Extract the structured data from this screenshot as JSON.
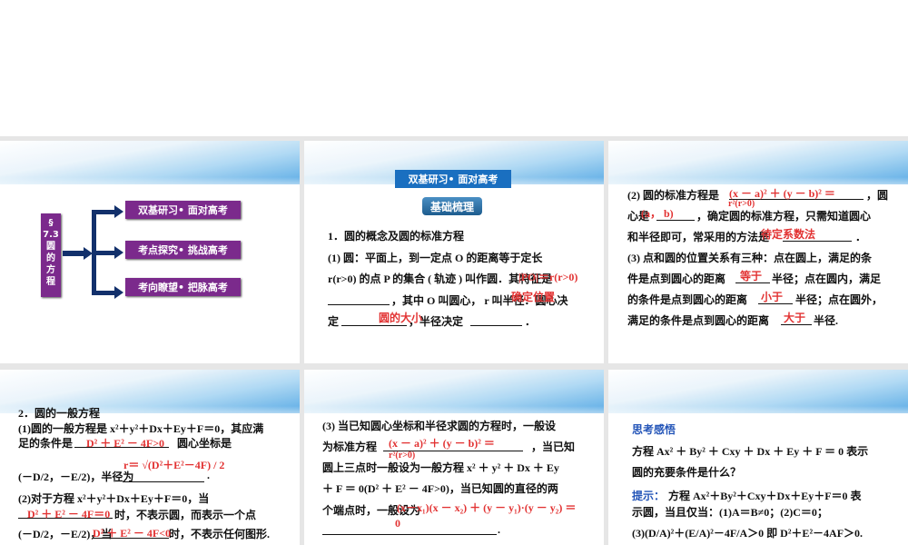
{
  "slide1": {
    "section": "§",
    "num": "7.3",
    "title_chars": [
      "圆",
      "的",
      "方",
      "程"
    ],
    "items": [
      "双基研习• 面对高考",
      "考点探究• 挑战高考",
      "考向瞭望• 把脉高考"
    ]
  },
  "slide2": {
    "banner": "双基研习• 面对高考",
    "tag": "基础梳理",
    "l1": "1．圆的概念及圆的标准方程",
    "l2": "(1) 圆：平面上，到一定点 O 的距离等于定长",
    "l3": "r(r>0) 的点 P 的集合 ( 轨迹 ) 叫作圆．其特征是",
    "l4": "，其中 O 叫圆心， r 叫半径．圆心决",
    "l5a": "定",
    "l5b": "，半径决定",
    "l5c": "．",
    "a1": "|PO|＝r(r>0)",
    "a2": "确定位置",
    "a3": "圆的大小"
  },
  "slide3": {
    "l1": "(2) 圆的标准方程是",
    "l1b": "，圆",
    "l2a": "心是",
    "l2b": "，确定圆的标准方程，只需知道圆心",
    "l3": "和半径即可，常采用的方法是",
    "l3b": "．",
    "l4": "(3) 点和圆的位置关系有三种：点在圆上，满足的条",
    "l5a": "件是点到圆心的距离",
    "l5b": "半径；点在圆内，满足",
    "l6a": "的条件是点到圆心的距离",
    "l6b": "半径；点在圆外，",
    "l7a": "满足的条件是点到圆心的距离",
    "l7b": "半径.",
    "a1": "(x － a)² ＋ (y － b)² ＝",
    "a1b": "r²(r>0)",
    "a2": "(a， b)",
    "a3": "待定系数法",
    "a4": "等于",
    "a5": "小于",
    "a6": "大于"
  },
  "slide4": {
    "l1": "2．圆的一般方程",
    "l2": "(1)圆的一般方程是  x²＋y²＋Dx＋Ey＋F＝0，其应满",
    "l3a": "足的条件是",
    "l3b": "圆心坐标是",
    "l4a": "(－D/2，－E/2)，半径为",
    "l4b": ".",
    "l5": "(2)对于方程 x²＋y²＋Dx＋Ey＋F＝0，当",
    "l6": "时，不表示圆，而表示一个点",
    "l7a": "(－D/2，－E/2)，当",
    "l7b": "时，不表示任何图形.",
    "a1": "D² ＋ E² － 4F>0",
    "a2": "r＝ √(D²＋E²－4F) / 2",
    "a3": "D² ＋ E² － 4F＝0",
    "a4": "D² ＋ E² － 4F<0"
  },
  "slide5": {
    "l1": "(3) 当已知圆心坐标和半径求圆的方程时，一般设",
    "l2a": "为标准方程",
    "l2b": "，当已知",
    "l3": "圆上三点时一般设为一般方程 x² ＋ y² ＋ Dx ＋ Ey",
    "l4": "＋ F ＝ 0(D² ＋ E² － 4F>0)，当已知圆的直径的两",
    "l5": "个端点时，一般设为",
    "l6": ".",
    "a1": "(x － a)² ＋ (y － b)² ＝",
    "a1b": "r²(r>0)",
    "a2": "(x－x₁)(x － x₂) ＋ (y － y₁)·(y － y₂) ＝",
    "a2b": "0"
  },
  "slide6": {
    "head": "思考感悟",
    "q1": "方程 Ax² ＋ By² ＋ Cxy ＋ Dx ＋ Ey ＋ F ＝ 0 表示",
    "q2": "圆的充要条件是什么？",
    "hint": "提示：",
    "h1": "方程 Ax²＋By²＋Cxy＋Dx＋Ey＋F＝0 表",
    "h2": "示圆，当且仅当：(1)A＝B≠0；(2)C＝0；",
    "h3": "(3)(D/A)²＋(E/A)²－4F/A＞0 即 D²＋E²－4AF＞0."
  }
}
